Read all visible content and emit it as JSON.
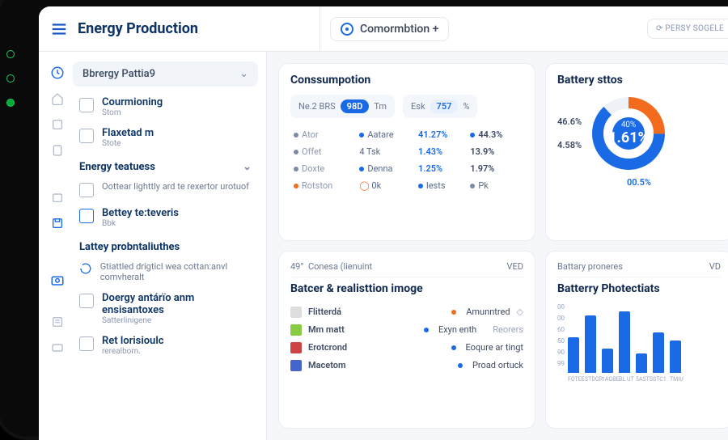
{
  "header": {
    "title": "Energy Production",
    "commorbtion_label": "Comormbtion +",
    "source_btn": "⟳ PERSY SOGELE"
  },
  "sidebar": {
    "groups": [
      {
        "title": "Bbrergy Pattia9",
        "items": [
          {
            "l1": "Courmioning",
            "l2": "Stom"
          },
          {
            "l1": "Flaxetad m",
            "l2": "Stote"
          }
        ]
      },
      {
        "title": "Energy teatuess",
        "items": [
          {
            "l1": "Oottear lighttly ard te rexertor urotuof",
            "l2": ""
          },
          {
            "l1": "Bettey te:teveris",
            "l2": "Bbk"
          }
        ]
      }
    ],
    "section3": {
      "title": "Lattey probntaliuthes",
      "items": [
        {
          "l1": "Gtiattled drigticl wea cottan:anvl comvheralt",
          "l2": ""
        },
        {
          "l1": "Doergy antárïo anm ensisantoxes",
          "l2": "Satterlinigene"
        },
        {
          "l1": "Ret lorisioulc",
          "l2": "rerealbom."
        }
      ]
    }
  },
  "consumption": {
    "title": "Conssumpotion",
    "pill_a_pre": "Ne.2 BRS",
    "pill_a_val": "98D",
    "pill_a_post": "Tm",
    "pill_b_pre": "Esk",
    "pill_b_val": "757",
    "pill_b_post": "%",
    "rows": [
      {
        "c1": "Ator",
        "c2": "Aatare",
        "v1": "41.27%",
        "v2": "44.3%"
      },
      {
        "c1": "Offet",
        "c2": "4  Tsk",
        "v1": "1.43%",
        "v2": "13.9%"
      },
      {
        "c1": "Doxte",
        "c2": "Denna",
        "v1": "1.25%",
        "v2": "1.97%"
      },
      {
        "c1": "Rotston",
        "c2": "0k",
        "v1": "lests",
        "v2": "Pk"
      }
    ]
  },
  "battery": {
    "title": "Battery sttos",
    "left_val": "46.6%",
    "right_val": "4.58%",
    "center_top": "40%",
    "center_main": "1.61%",
    "below": "00.5%"
  },
  "lower_left": {
    "sub_pre": "49°",
    "sub_txt": "Conesa (lienuint",
    "sub_right": "VED",
    "title": "Batcer & realisttion imoge",
    "rows": [
      {
        "name": "Flitterdá",
        "c2": "Amunntred",
        "c3": "◇"
      },
      {
        "name": "Mm matt",
        "c2": "Exyn enth",
        "c3": "Reorers"
      },
      {
        "name": "Erotcrond",
        "c2": "Eoqure ar tingt",
        "c3": ""
      },
      {
        "name": "Macetom",
        "c2": "Proad ortuck",
        "c3": ""
      }
    ]
  },
  "lower_right": {
    "sub_txt": "Battary proneres",
    "sub_right": "VD",
    "title": "Batterry Photectiats",
    "chart_data": {
      "type": "bar",
      "categories": [
        "FOTEE",
        "STDGR",
        "1AGBE",
        "BL.UT",
        "5ASTS",
        "STC1",
        "TMIU"
      ],
      "values": [
        54,
        88,
        37,
        95,
        30,
        62,
        49
      ],
      "ylabel": "",
      "xlabel": "",
      "ylim": [
        0,
        100
      ],
      "yticks": [
        "00",
        "00",
        "60",
        "50",
        "90",
        "99"
      ]
    }
  }
}
